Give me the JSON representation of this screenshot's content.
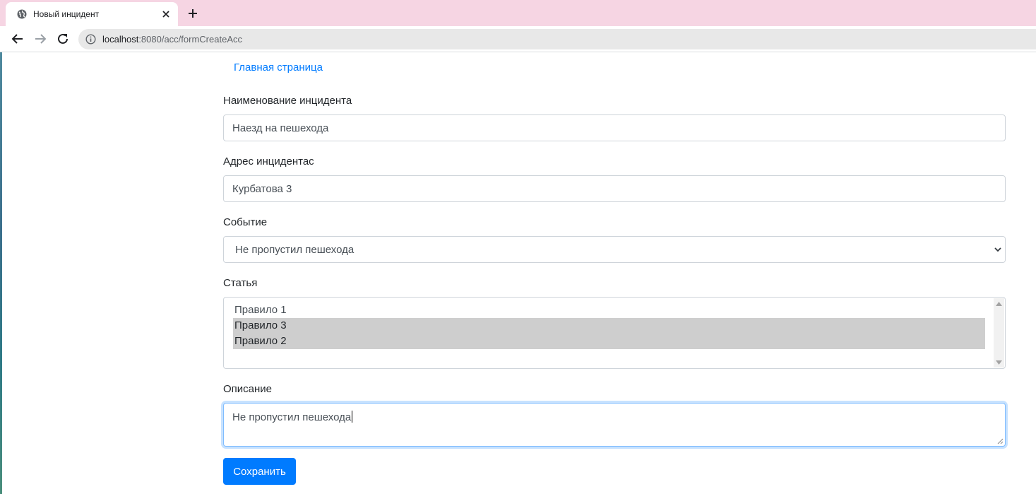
{
  "browser": {
    "tab_title": "Новый инцидент",
    "url_host": "localhost",
    "url_rest": ":8080/acc/formCreateAcc"
  },
  "nav": {
    "home_link": "Главная страница"
  },
  "form": {
    "name_label": "Наименование инцидента",
    "name_value": "Наезд на пешехода",
    "address_label": "Адрес инцидентас",
    "address_value": "Курбатова 3",
    "event_label": "Событие",
    "event_selected": "Не пропустил пешехода",
    "article_label": "Статья",
    "article_options": [
      {
        "label": "Правило 1",
        "selected": false
      },
      {
        "label": "Правило 3",
        "selected": true
      },
      {
        "label": "Правило 2",
        "selected": true
      }
    ],
    "description_label": "Описание",
    "description_value": "Не пропустил пешехода",
    "submit_label": "Сохранить"
  },
  "colors": {
    "accent": "#007bff",
    "tabbar": "#f6d5e3",
    "selected_option": "#cecece"
  }
}
